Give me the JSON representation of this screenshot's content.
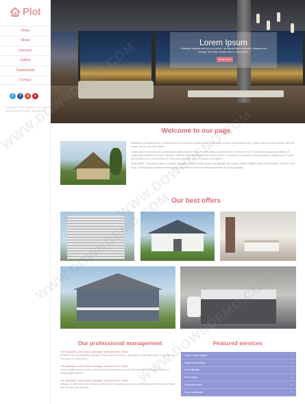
{
  "brand": {
    "name": "Plot",
    "accent": "#d9737b"
  },
  "nav": {
    "items": [
      "Home",
      "About",
      "Services",
      "Gallery",
      "Testimonials",
      "Contact"
    ]
  },
  "social": {
    "icons": [
      "twitter-icon",
      "facebook-icon",
      "google-plus-icon",
      "pinterest-icon"
    ],
    "glyphs": [
      "t",
      "f",
      "g",
      "p"
    ],
    "colors": [
      "#3aa8e0",
      "#3b5998",
      "#d9473b",
      "#cb2027"
    ]
  },
  "sidebar": {
    "copyright": "Copyright © 2016 Company name. All rights reserved. Design: Templatemo"
  },
  "hero": {
    "title": "Lorem Ipsum",
    "subtitle": "Phasellus dapibus ante id urna dictum, vel blandit libero convallis. Aliquam erat volutpat. Sed vitae semper nisi, id luctus lorem.",
    "button": "Read more"
  },
  "welcome": {
    "title": "Welcome to our page",
    "paragraphs": [
      "Building for parallax theme. Lorem ipsum sit commodo condimentum. Nulla mollis id dolor consectetur enim. Nullam dolor sit amet massa. Sed vel lectus. Donec vel enim varius.",
      "Lorem ipsum dolor sit amet, consectetur adipiscing elit. Fusce at nibh tempus, pharetra leo a, tincidunt nunc. Cum sociis natoque penatibus et magnis dis parturient montes, nascetur ridiculus mus. Vestibulum ante ipsum primis in faucibus orci luctus et ultrices posuere cubilia curae. Donec quis tincidunt leo, at bibendum mi. Sed porta molestie sem, in tempor ex feugiat in.",
      "Nulla facilisi. Vivamus tempus ac magna id mattis. Nam at iaculis ipsum, sed egestas elit. Integer blandit sagittis turpis ac fermentum. Mauris id elit lacus. Pellentesque habitant morbi tristique senectus et netus et malesuada fames ac turpis egestas."
    ]
  },
  "offers": {
    "title": "Our best offers"
  },
  "management": {
    "title": "Our professional management",
    "items": [
      {
        "heading": "The standard Lorem Ipsum passage, used since the 1500s",
        "text": "Sit amet eros id scelerisque vulputate. Nunc rutrum nibh lacus, eget ultrices urna ullamcorper in. Sed tempor nec ipsum eu elementum."
      },
      {
        "heading": "The standard Lorem Ipsum passage, used since the 1500s",
        "text": "Donec sagittis rhoncus lorem, sed commodo dui posuere sit amet. Morbi blandit lectus id sem lacinia, a suscipit ligula lobortis."
      },
      {
        "heading": "The standard Lorem Ipsum passage, used since the 1500s",
        "text": "Quisque ut velit vitae lacus fermentum hendrerit. Ut gravida lacus elit, vel pellentesque mi vehicula at. Etiam sed erat sed odio vehicula."
      }
    ]
  },
  "featured": {
    "title": "Featured services",
    "items": [
      "Nunc in felis aliquet",
      "Fusce consectetur",
      "Duis egestas",
      "Sed lobortis",
      "Phasellus enim",
      "Nunc sollicitudin"
    ]
  },
  "watermark": "WWW.DOWNDEMO.COM"
}
